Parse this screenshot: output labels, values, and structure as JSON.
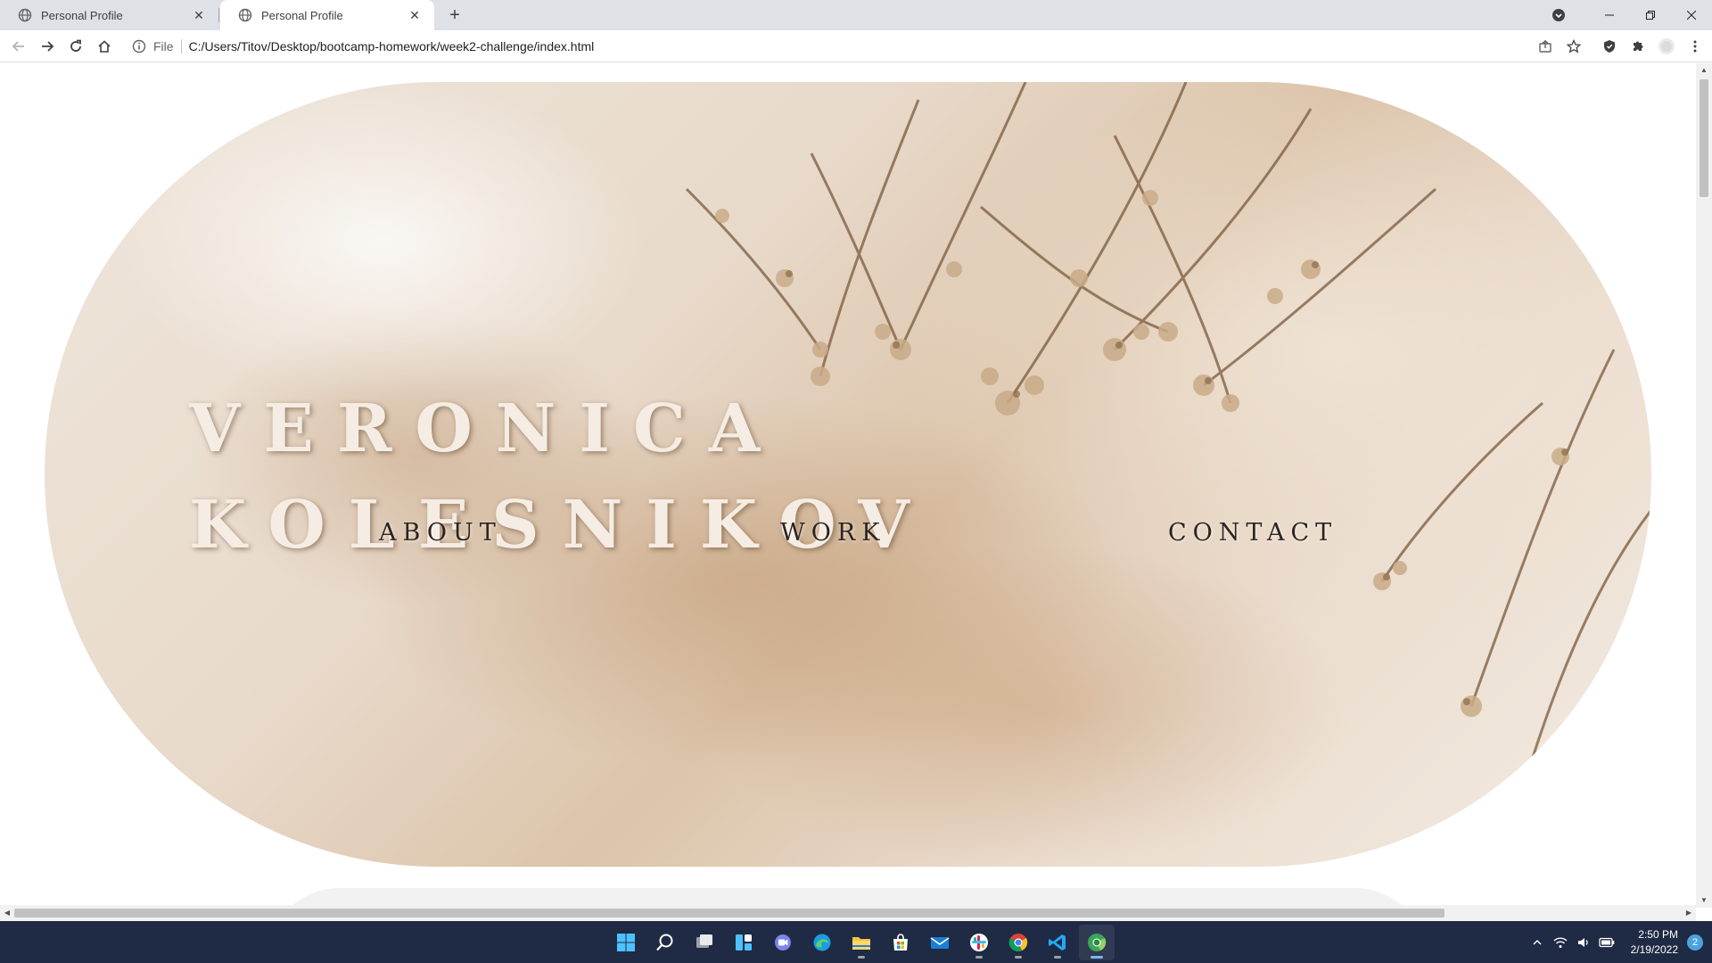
{
  "browser": {
    "tabs": [
      {
        "title": "Personal Profile",
        "active": false
      },
      {
        "title": "Personal Profile",
        "active": true
      }
    ],
    "address": {
      "scheme_label": "File",
      "url": "C:/Users/Titov/Desktop/bootcamp-homework/week2-challenge/index.html"
    }
  },
  "page": {
    "hero": {
      "name_line1": "VERONICA",
      "name_line2": "KOLESNIKOV"
    },
    "nav": [
      {
        "label": "ABOUT"
      },
      {
        "label": "WORK"
      },
      {
        "label": "CONTACT"
      }
    ]
  },
  "taskbar": {
    "apps": [
      "start-icon",
      "search-icon",
      "task-view-icon",
      "widgets-icon",
      "teams-chat-icon",
      "edge-icon",
      "file-explorer-icon",
      "store-icon",
      "mail-icon",
      "slack-icon",
      "chrome-icon",
      "vscode-icon",
      "chrome-canary-icon"
    ],
    "time": "2:50 PM",
    "date": "2/19/2022",
    "notification_count": "2"
  },
  "colors": {
    "tabbar_bg": "#dee1e6",
    "taskbar_bg": "#1f2a44",
    "hero_text": "#f5ece3",
    "nav_text": "#2b2420",
    "hero_base": "#e8dacb"
  }
}
